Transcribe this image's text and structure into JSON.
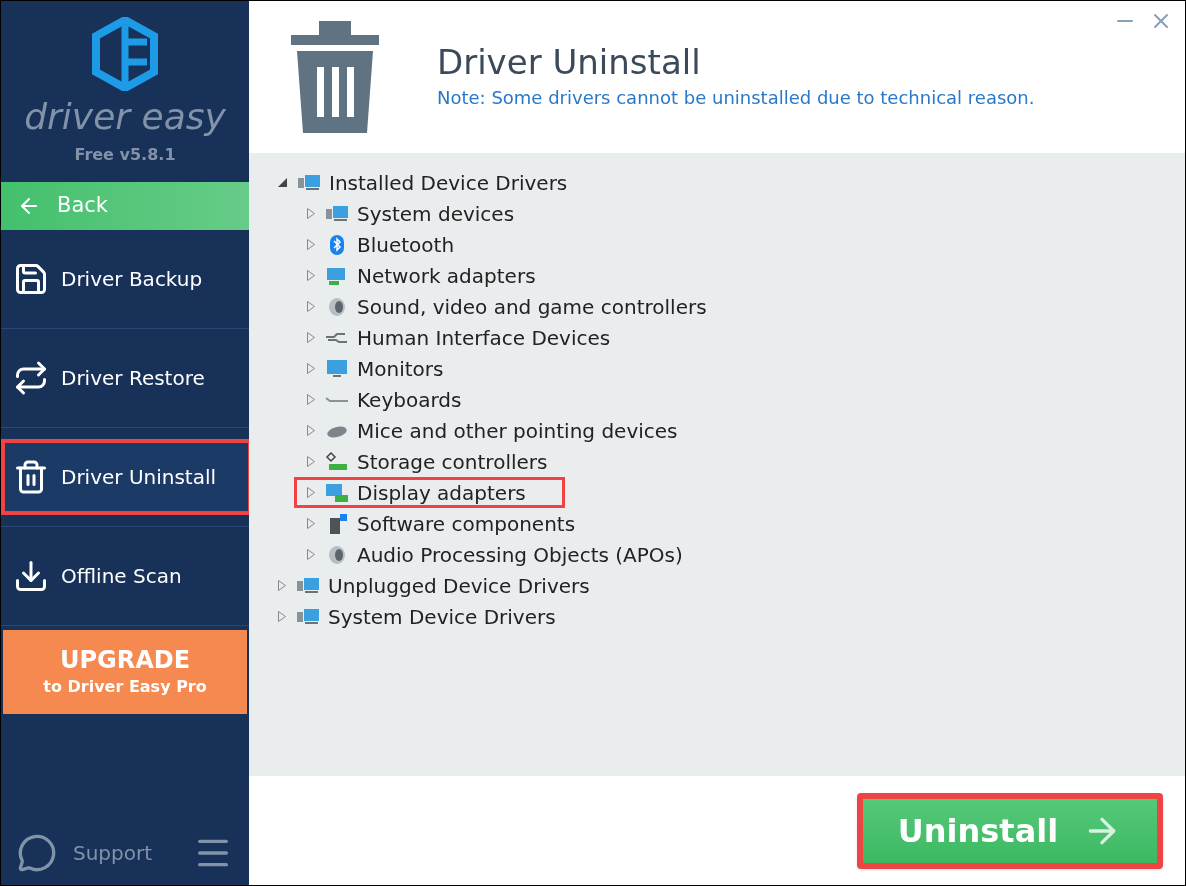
{
  "sidebar": {
    "logo_text": "driver easy",
    "version": "Free v5.8.1",
    "back": "Back",
    "items": [
      {
        "label": "Driver Backup",
        "kind": "floppy",
        "selected": false,
        "highlighted": false
      },
      {
        "label": "Driver Restore",
        "kind": "arrows",
        "selected": false,
        "highlighted": false
      },
      {
        "label": "Driver Uninstall",
        "kind": "trash",
        "selected": true,
        "highlighted": true
      },
      {
        "label": "Offline Scan",
        "kind": "download",
        "selected": false,
        "highlighted": false
      }
    ],
    "upgrade": {
      "title": "UPGRADE",
      "subtitle": "to Driver Easy Pro"
    },
    "support": "Support"
  },
  "header": {
    "title": "Driver Uninstall",
    "note": "Note: Some drivers cannot be uninstalled due to technical reason."
  },
  "tree": [
    {
      "label": "Installed Device Drivers",
      "kind": "computer",
      "expanded": true,
      "highlighted": false,
      "children": [
        {
          "label": "System devices",
          "kind": "computer",
          "expanded": false,
          "highlighted": false
        },
        {
          "label": "Bluetooth",
          "kind": "bluetooth",
          "expanded": false,
          "highlighted": false
        },
        {
          "label": "Network adapters",
          "kind": "network",
          "expanded": false,
          "highlighted": false
        },
        {
          "label": "Sound, video and game controllers",
          "kind": "speaker",
          "expanded": false,
          "highlighted": false
        },
        {
          "label": "Human Interface Devices",
          "kind": "hid",
          "expanded": false,
          "highlighted": false
        },
        {
          "label": "Monitors",
          "kind": "monitor",
          "expanded": false,
          "highlighted": false
        },
        {
          "label": "Keyboards",
          "kind": "keyboard",
          "expanded": false,
          "highlighted": false
        },
        {
          "label": "Mice and other pointing devices",
          "kind": "mouse",
          "expanded": false,
          "highlighted": false
        },
        {
          "label": "Storage controllers",
          "kind": "storage",
          "expanded": false,
          "highlighted": false
        },
        {
          "label": "Display adapters",
          "kind": "display",
          "expanded": false,
          "highlighted": true
        },
        {
          "label": "Software components",
          "kind": "software",
          "expanded": false,
          "highlighted": false
        },
        {
          "label": "Audio Processing Objects (APOs)",
          "kind": "speaker",
          "expanded": false,
          "highlighted": false
        }
      ]
    },
    {
      "label": "Unplugged Device Drivers",
      "kind": "computer",
      "expanded": false,
      "highlighted": false
    },
    {
      "label": "System Device Drivers",
      "kind": "computer",
      "expanded": false,
      "highlighted": false
    }
  ],
  "uninstall_button": {
    "label": "Uninstall",
    "highlighted": true
  }
}
